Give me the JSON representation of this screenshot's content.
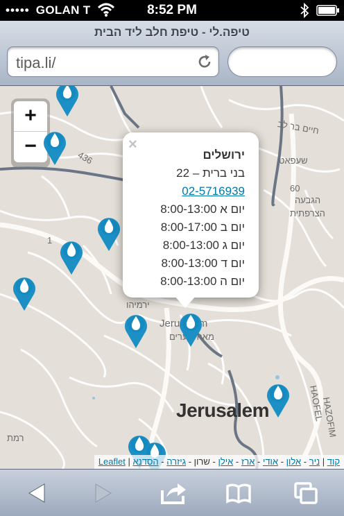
{
  "status_bar": {
    "carrier": "GOLAN T",
    "signal": "•••••",
    "time": "8:52 PM"
  },
  "browser": {
    "page_title": "טיפה.לי - טיפת חלב ליד הבית",
    "url": "tipa.li/",
    "search_placeholder": ""
  },
  "map": {
    "zoom_in_label": "+",
    "zoom_out_label": "−",
    "city_label": "Jerusalem",
    "labels": [
      {
        "text": "שעפאט"
      },
      {
        "text": "הגבעה"
      },
      {
        "text": "הצרפתית"
      },
      {
        "text": "חיים בר לב"
      },
      {
        "text": "ירמיהו"
      },
      {
        "text": "Jerusalem"
      },
      {
        "text": "מאה שערים"
      },
      {
        "text": "HAOFEL"
      },
      {
        "text": "HAZOFIM"
      },
      {
        "text": "רמת"
      },
      {
        "text": "436"
      },
      {
        "text": "60"
      },
      {
        "text": "1"
      }
    ],
    "popup": {
      "close_label": "×",
      "city": "ירושלים",
      "address": "בני ברית – 22",
      "phone": "02-5716939",
      "hours": [
        "יום א 8:00-13:00",
        "יום ב 8:00-17:00",
        "יום ג 8:00-13:00",
        "יום ד 8:00-13:00",
        "יום ה 8:00-13:00"
      ]
    },
    "attribution": {
      "links": [
        "קוד",
        "ניר",
        "אלון",
        "אודי",
        "ארז",
        "אילן",
        "שרון",
        "גיזרה",
        "הסדנא",
        "Leaflet"
      ]
    },
    "marker_color": "#1c8fc4"
  },
  "toolbar": {
    "back": "back-icon",
    "forward": "forward-icon",
    "share": "share-icon",
    "bookmarks": "bookmarks-icon",
    "tabs": "tabs-icon"
  }
}
